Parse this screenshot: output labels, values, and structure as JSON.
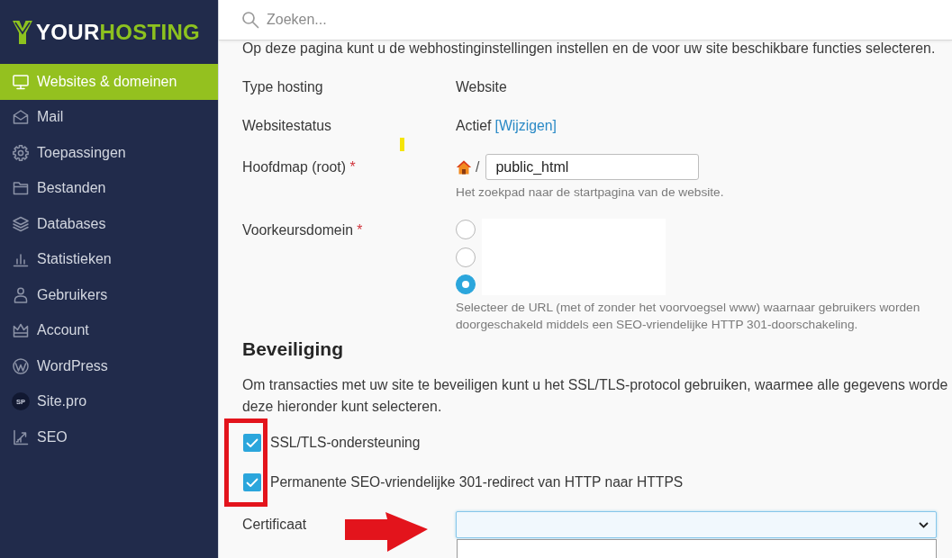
{
  "sidebar": {
    "logo": {
      "prefix": "YOUR",
      "suffix": "HOSTING"
    },
    "items": [
      {
        "label": "Websites & domeinen",
        "selected": true
      },
      {
        "label": "Mail",
        "selected": false
      },
      {
        "label": "Toepassingen",
        "selected": false
      },
      {
        "label": "Bestanden",
        "selected": false
      },
      {
        "label": "Databases",
        "selected": false
      },
      {
        "label": "Statistieken",
        "selected": false
      },
      {
        "label": "Gebruikers",
        "selected": false
      },
      {
        "label": "Account",
        "selected": false
      },
      {
        "label": "WordPress",
        "selected": false
      },
      {
        "label": "Site.pro",
        "selected": false,
        "badge": "SP"
      },
      {
        "label": "SEO",
        "selected": false
      }
    ]
  },
  "search": {
    "placeholder": "Zoeken..."
  },
  "intro": "Op deze pagina kunt u de webhostinginstellingen instellen en de voor uw site beschikbare functies selecteren.",
  "settings": [
    {
      "kind": "text",
      "label": "Type hosting",
      "value": "Website"
    },
    {
      "kind": "status",
      "label": "Websitestatus",
      "value": "Actief",
      "link": "[Wijzigen]"
    },
    {
      "kind": "path",
      "label": "Hoofdmap (root)",
      "required_mark": "*",
      "separator": "/",
      "value": "public_html",
      "hint": [
        "Het zoekpad naar de startpagina van de website."
      ]
    },
    {
      "kind": "radio",
      "label": "Voorkeursdomein",
      "required_mark": "*",
      "options": [
        {
          "selected": false
        },
        {
          "selected": false
        },
        {
          "selected": true
        }
      ],
      "hint": [
        "Selecteer de URL (met of zonder het voorvoegsel www) waarnaar gebruikers worden",
        "doorgeschakeld middels een SEO-vriendelijke HTTP 301-doorschakeling."
      ]
    }
  ],
  "security": {
    "heading": "Beveiliging",
    "description": [
      "Om transacties met uw site te beveiligen kunt u het SSL/TLS-protocol gebruiken, waarmee alle gegevens worde",
      "deze hieronder kunt selecteren."
    ],
    "options": [
      {
        "label": "SSL/TLS-ondersteuning",
        "checked": true
      },
      {
        "label": "Permanente SEO-vriendelijke 301-redirect van HTTP naar HTTPS",
        "checked": true
      }
    ],
    "certificate": {
      "label": "Certificaat",
      "expanded": true
    }
  }
}
